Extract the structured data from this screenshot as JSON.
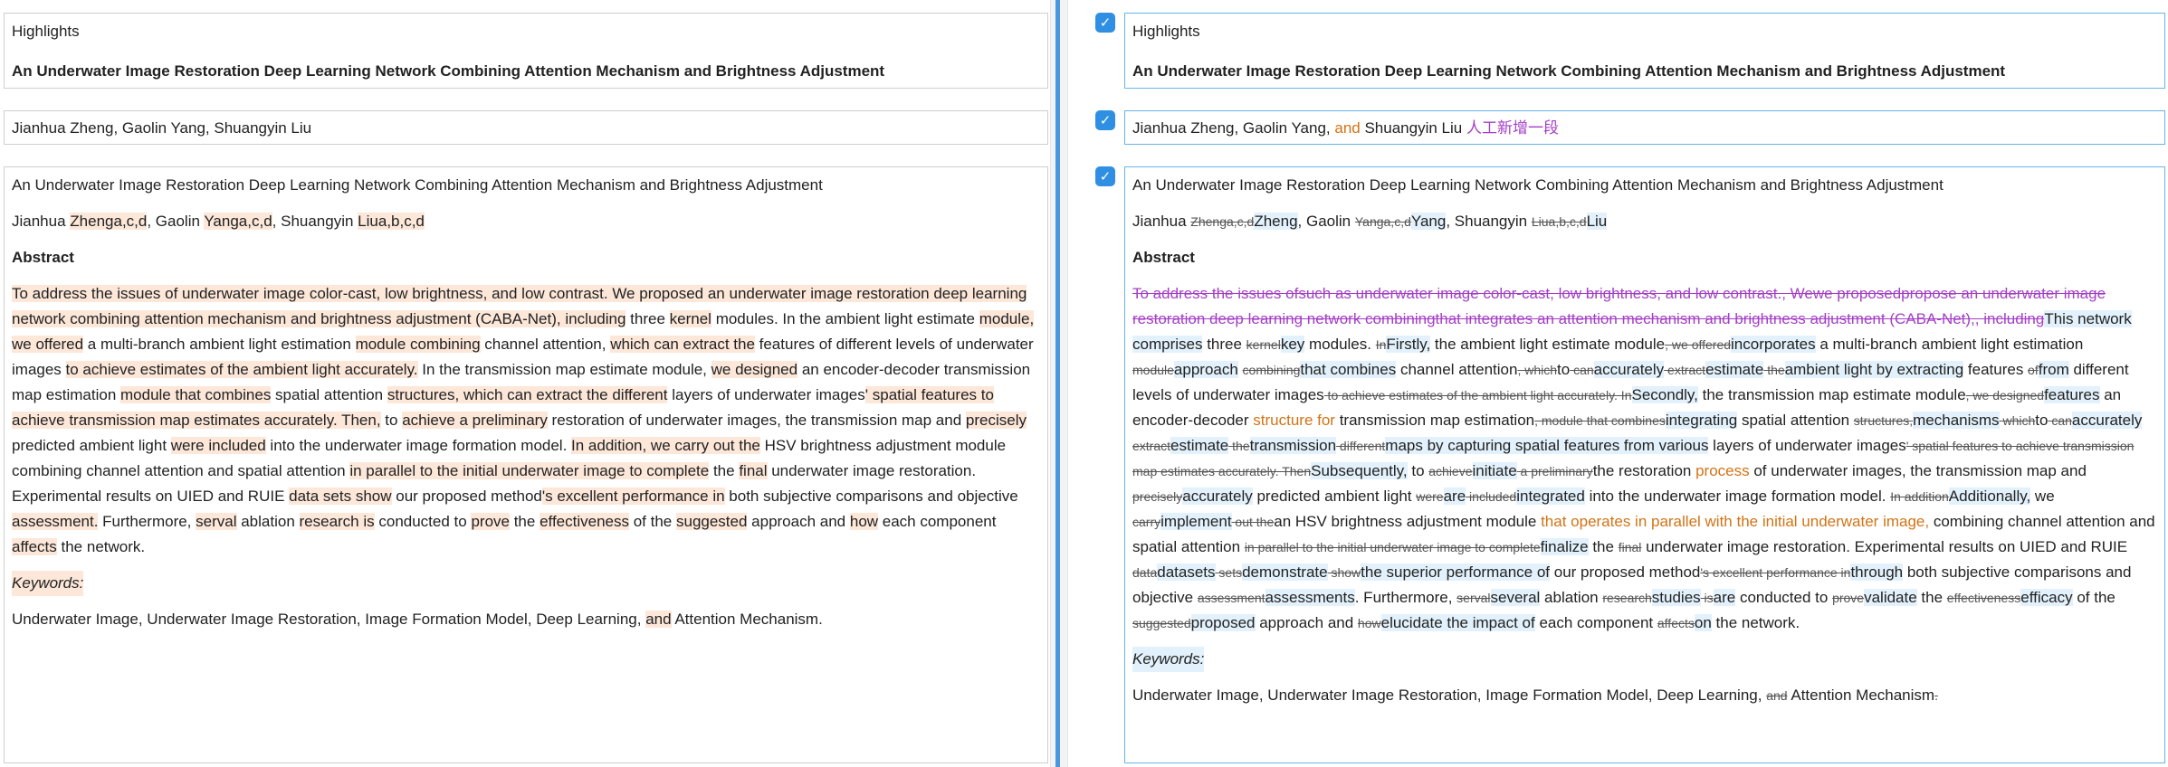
{
  "left": {
    "block1": {
      "label": "Highlights",
      "title": "An Underwater Image Restoration Deep Learning Network Combining Attention Mechanism and Brightness Adjustment"
    },
    "block2": {
      "authors": "Jianhua Zheng, Gaolin Yang, Shuangyin Liu"
    },
    "block3": {
      "title": "An Underwater Image Restoration Deep Learning Network Combining Attention Mechanism and Brightness Adjustment",
      "authors_segments": [
        {
          "t": "Jianhua ",
          "s": ""
        },
        {
          "t": "Zhenga,c,d",
          "s": "hl"
        },
        {
          "t": ", Gaolin ",
          "s": ""
        },
        {
          "t": "Yanga,c,d",
          "s": "hl"
        },
        {
          "t": ", Shuangyin ",
          "s": ""
        },
        {
          "t": "Liua,b,c,d",
          "s": "hl"
        }
      ],
      "abstract_heading": "Abstract",
      "abstract_segments": [
        {
          "t": "To address the issues of underwater image color-cast, low brightness, and low contrast. We proposed an underwater image restoration deep learning network combining attention mechanism and brightness adjustment (CABA-Net), including",
          "s": "hl"
        },
        {
          "t": " three ",
          "s": ""
        },
        {
          "t": "kernel",
          "s": "hl"
        },
        {
          "t": " modules. In the ambient light estimate ",
          "s": ""
        },
        {
          "t": "module, we offered",
          "s": "hl"
        },
        {
          "t": " a multi-branch ambient light estimation ",
          "s": ""
        },
        {
          "t": "module combining",
          "s": "hl"
        },
        {
          "t": " channel attention, ",
          "s": ""
        },
        {
          "t": "which can extract the",
          "s": "hl"
        },
        {
          "t": " features of different levels of underwater images ",
          "s": ""
        },
        {
          "t": "to achieve estimates of the ambient light accurately.",
          "s": "hl"
        },
        {
          "t": " In the transmission map estimate module, ",
          "s": ""
        },
        {
          "t": "we designed",
          "s": "hl"
        },
        {
          "t": " an encoder-decoder transmission map estimation ",
          "s": ""
        },
        {
          "t": "module that combines",
          "s": "hl"
        },
        {
          "t": " spatial attention ",
          "s": ""
        },
        {
          "t": "structures, which can extract the different",
          "s": "hl"
        },
        {
          "t": " layers of underwater images",
          "s": ""
        },
        {
          "t": "' spatial features to achieve transmission map estimates accurately. Then,",
          "s": "hl"
        },
        {
          "t": " to ",
          "s": ""
        },
        {
          "t": "achieve a preliminary",
          "s": "hl"
        },
        {
          "t": " restoration of underwater images, the transmission map and ",
          "s": ""
        },
        {
          "t": "precisely",
          "s": "hl"
        },
        {
          "t": " predicted ambient light ",
          "s": ""
        },
        {
          "t": "were included",
          "s": "hl"
        },
        {
          "t": " into the underwater image formation model. ",
          "s": ""
        },
        {
          "t": "In addition, we carry out the",
          "s": "hl"
        },
        {
          "t": " HSV brightness adjustment module combining channel attention and spatial attention ",
          "s": ""
        },
        {
          "t": "in parallel to the initial underwater image to complete",
          "s": "hl"
        },
        {
          "t": " the ",
          "s": ""
        },
        {
          "t": "final",
          "s": "hl"
        },
        {
          "t": " underwater image restoration. Experimental results on UIED and RUIE ",
          "s": ""
        },
        {
          "t": "data sets show",
          "s": "hl"
        },
        {
          "t": " our proposed method",
          "s": ""
        },
        {
          "t": "'s excellent performance in",
          "s": "hl"
        },
        {
          "t": " both subjective comparisons and objective ",
          "s": ""
        },
        {
          "t": "assessment.",
          "s": "hl"
        },
        {
          "t": " Furthermore, ",
          "s": ""
        },
        {
          "t": "serval",
          "s": "hl"
        },
        {
          "t": " ablation ",
          "s": ""
        },
        {
          "t": "research is",
          "s": "hl"
        },
        {
          "t": " conducted to ",
          "s": ""
        },
        {
          "t": "prove",
          "s": "hl"
        },
        {
          "t": " the ",
          "s": ""
        },
        {
          "t": "effectiveness",
          "s": "hl"
        },
        {
          "t": " of the ",
          "s": ""
        },
        {
          "t": "suggested",
          "s": "hl"
        },
        {
          "t": " approach and ",
          "s": ""
        },
        {
          "t": "how",
          "s": "hl"
        },
        {
          "t": " each component ",
          "s": ""
        },
        {
          "t": "affects",
          "s": "hl"
        },
        {
          "t": " the network.",
          "s": ""
        }
      ],
      "keywords_heading": "Keywords:",
      "keywords_segments": [
        {
          "t": "Underwater Image, Underwater Image Restoration, Image Formation Model, Deep Learning, ",
          "s": ""
        },
        {
          "t": "and",
          "s": "hl"
        },
        {
          "t": " Attention Mechanism.",
          "s": ""
        }
      ]
    }
  },
  "right": {
    "block1": {
      "label": "Highlights",
      "title": "An Underwater Image Restoration Deep Learning Network Combining Attention Mechanism and Brightness Adjustment"
    },
    "block2": {
      "segments": [
        {
          "t": "Jianhua Zheng, Gaolin Yang, ",
          "s": ""
        },
        {
          "t": "and",
          "s": "orange"
        },
        {
          "t": " Shuangyin Liu ",
          "s": ""
        },
        {
          "t": "人工新增一段",
          "s": "purple"
        }
      ]
    },
    "block3": {
      "title": "An Underwater Image Restoration Deep Learning Network Combining Attention Mechanism and Brightness Adjustment",
      "authors_segments": [
        {
          "t": "Jianhua ",
          "s": ""
        },
        {
          "t": "Zhenga,c,d",
          "s": "del"
        },
        {
          "t": "Zheng",
          "s": "ins"
        },
        {
          "t": ", Gaolin ",
          "s": ""
        },
        {
          "t": "Yanga,c,d",
          "s": "del"
        },
        {
          "t": "Yang",
          "s": "ins"
        },
        {
          "t": ", Shuangyin ",
          "s": ""
        },
        {
          "t": "Liua,b,c,d",
          "s": "del"
        },
        {
          "t": "Liu",
          "s": "ins"
        }
      ],
      "abstract_heading": "Abstract",
      "abstract_segments": [
        {
          "t": "To address the issues ofsuch as underwater image color-cast, low brightness, and low contrast., Wewe proposedpropose an underwater image restoration deep learning network combiningthat integrates an attention mechanism and brightness adjustment (CABA-Net),, including",
          "s": "delp"
        },
        {
          "t": "This network comprises",
          "s": "ins"
        },
        {
          "t": " three ",
          "s": ""
        },
        {
          "t": "kernel",
          "s": "del"
        },
        {
          "t": "key",
          "s": "ins"
        },
        {
          "t": " modules. ",
          "s": ""
        },
        {
          "t": "In",
          "s": "del"
        },
        {
          "t": "Firstly,",
          "s": "ins"
        },
        {
          "t": " the ambient light estimate module",
          "s": ""
        },
        {
          "t": ", we offered",
          "s": "del"
        },
        {
          "t": "incorporates",
          "s": "ins"
        },
        {
          "t": " a multi-branch ambient light estimation ",
          "s": ""
        },
        {
          "t": "module",
          "s": "del"
        },
        {
          "t": "approach",
          "s": "ins"
        },
        {
          "t": " ",
          "s": ""
        },
        {
          "t": "combining",
          "s": "del"
        },
        {
          "t": "that combines",
          "s": "ins"
        },
        {
          "t": " channel attention",
          "s": ""
        },
        {
          "t": ", which",
          "s": "del"
        },
        {
          "t": "to",
          "s": ""
        },
        {
          "t": " can",
          "s": "del"
        },
        {
          "t": "accurately",
          "s": "ins"
        },
        {
          "t": " extract",
          "s": "del"
        },
        {
          "t": "estimate",
          "s": "ins"
        },
        {
          "t": " the",
          "s": "del"
        },
        {
          "t": "ambient light by extracting",
          "s": "ins"
        },
        {
          "t": " features ",
          "s": ""
        },
        {
          "t": "of",
          "s": "del"
        },
        {
          "t": "from",
          "s": "ins"
        },
        {
          "t": " different levels of underwater images",
          "s": ""
        },
        {
          "t": " to achieve estimates of the ambient light accurately.",
          "s": "del"
        },
        {
          "t": " In",
          "s": "del"
        },
        {
          "t": "Secondly,",
          "s": "ins"
        },
        {
          "t": " the transmission map estimate module",
          "s": ""
        },
        {
          "t": ", we designed",
          "s": "del"
        },
        {
          "t": "features",
          "s": "ins"
        },
        {
          "t": " an encoder-decoder ",
          "s": ""
        },
        {
          "t": "structure for",
          "s": "orange"
        },
        {
          "t": " transmission map estimation",
          "s": ""
        },
        {
          "t": ", module that combines",
          "s": "del"
        },
        {
          "t": "integrating",
          "s": "ins"
        },
        {
          "t": " spatial attention ",
          "s": ""
        },
        {
          "t": "structures,",
          "s": "del"
        },
        {
          "t": "mechanisms",
          "s": "ins"
        },
        {
          "t": " which",
          "s": "del"
        },
        {
          "t": "to",
          "s": ""
        },
        {
          "t": " can",
          "s": "del"
        },
        {
          "t": "accurately",
          "s": "ins"
        },
        {
          "t": " extract",
          "s": "del"
        },
        {
          "t": "estimate",
          "s": "ins"
        },
        {
          "t": " the",
          "s": "del"
        },
        {
          "t": "transmission",
          "s": "ins"
        },
        {
          "t": " different",
          "s": "del"
        },
        {
          "t": "maps by capturing spatial features from various",
          "s": "ins"
        },
        {
          "t": " layers of underwater images",
          "s": ""
        },
        {
          "t": "' spatial features to achieve transmission map estimates accurately. Then",
          "s": "del"
        },
        {
          "t": "Subsequently,",
          "s": "ins"
        },
        {
          "t": " to ",
          "s": ""
        },
        {
          "t": "achieve",
          "s": "del"
        },
        {
          "t": "initiate",
          "s": "ins"
        },
        {
          "t": " a preliminary",
          "s": "del"
        },
        {
          "t": "the restoration ",
          "s": ""
        },
        {
          "t": "process",
          "s": "orange"
        },
        {
          "t": " of underwater images, the transmission map and ",
          "s": ""
        },
        {
          "t": "precisely",
          "s": "del"
        },
        {
          "t": "accurately",
          "s": "ins"
        },
        {
          "t": " predicted ambient light ",
          "s": ""
        },
        {
          "t": "were",
          "s": "del"
        },
        {
          "t": "are",
          "s": "ins"
        },
        {
          "t": " included",
          "s": "del"
        },
        {
          "t": "integrated",
          "s": "ins"
        },
        {
          "t": " into the underwater image formation model. ",
          "s": ""
        },
        {
          "t": "In addition",
          "s": "del"
        },
        {
          "t": "Additionally,",
          "s": "ins"
        },
        {
          "t": " we ",
          "s": ""
        },
        {
          "t": "carry",
          "s": "del"
        },
        {
          "t": "implement",
          "s": "ins"
        },
        {
          "t": " out the",
          "s": "del"
        },
        {
          "t": "an HSV brightness adjustment module ",
          "s": ""
        },
        {
          "t": "that operates in parallel with the initial underwater image,",
          "s": "orange"
        },
        {
          "t": " combining channel attention and spatial attention ",
          "s": ""
        },
        {
          "t": "in parallel to the initial underwater image to complete",
          "s": "del"
        },
        {
          "t": "finalize",
          "s": "ins"
        },
        {
          "t": " the ",
          "s": ""
        },
        {
          "t": "final",
          "s": "del"
        },
        {
          "t": " underwater image restoration. Experimental results on UIED and RUIE ",
          "s": ""
        },
        {
          "t": "data",
          "s": "del"
        },
        {
          "t": "datasets",
          "s": "ins"
        },
        {
          "t": " sets",
          "s": "del"
        },
        {
          "t": "demonstrate",
          "s": "ins"
        },
        {
          "t": " show",
          "s": "del"
        },
        {
          "t": "the superior performance of",
          "s": "ins"
        },
        {
          "t": " our proposed method",
          "s": ""
        },
        {
          "t": "'s excellent performance in",
          "s": "del"
        },
        {
          "t": "through",
          "s": "ins"
        },
        {
          "t": " both subjective comparisons and objective ",
          "s": ""
        },
        {
          "t": "assessment",
          "s": "del"
        },
        {
          "t": "assessments",
          "s": "ins"
        },
        {
          "t": ". Furthermore, ",
          "s": ""
        },
        {
          "t": "serval",
          "s": "del"
        },
        {
          "t": "several",
          "s": "ins"
        },
        {
          "t": " ablation ",
          "s": ""
        },
        {
          "t": "research",
          "s": "del"
        },
        {
          "t": "studies",
          "s": "ins"
        },
        {
          "t": " is",
          "s": "del"
        },
        {
          "t": "are",
          "s": "ins"
        },
        {
          "t": " conducted to ",
          "s": ""
        },
        {
          "t": "prove",
          "s": "del"
        },
        {
          "t": "validate",
          "s": "ins"
        },
        {
          "t": " the ",
          "s": ""
        },
        {
          "t": "effectiveness",
          "s": "del"
        },
        {
          "t": "efficacy",
          "s": "ins"
        },
        {
          "t": " of the ",
          "s": ""
        },
        {
          "t": "suggested",
          "s": "del"
        },
        {
          "t": "proposed",
          "s": "ins"
        },
        {
          "t": " approach and ",
          "s": ""
        },
        {
          "t": "how",
          "s": "del"
        },
        {
          "t": "elucidate the impact of",
          "s": "ins"
        },
        {
          "t": " each component ",
          "s": ""
        },
        {
          "t": "affects",
          "s": "del"
        },
        {
          "t": "on",
          "s": "ins"
        },
        {
          "t": " the network.",
          "s": ""
        }
      ],
      "keywords_heading": "Keywords:",
      "keywords_segments": [
        {
          "t": "Underwater Image, Underwater Image Restoration, Image Formation Model, Deep Learning, ",
          "s": ""
        },
        {
          "t": "and",
          "s": "del"
        },
        {
          "t": " Attention Mechanism",
          "s": ""
        },
        {
          "t": ".",
          "s": "del"
        }
      ]
    }
  }
}
